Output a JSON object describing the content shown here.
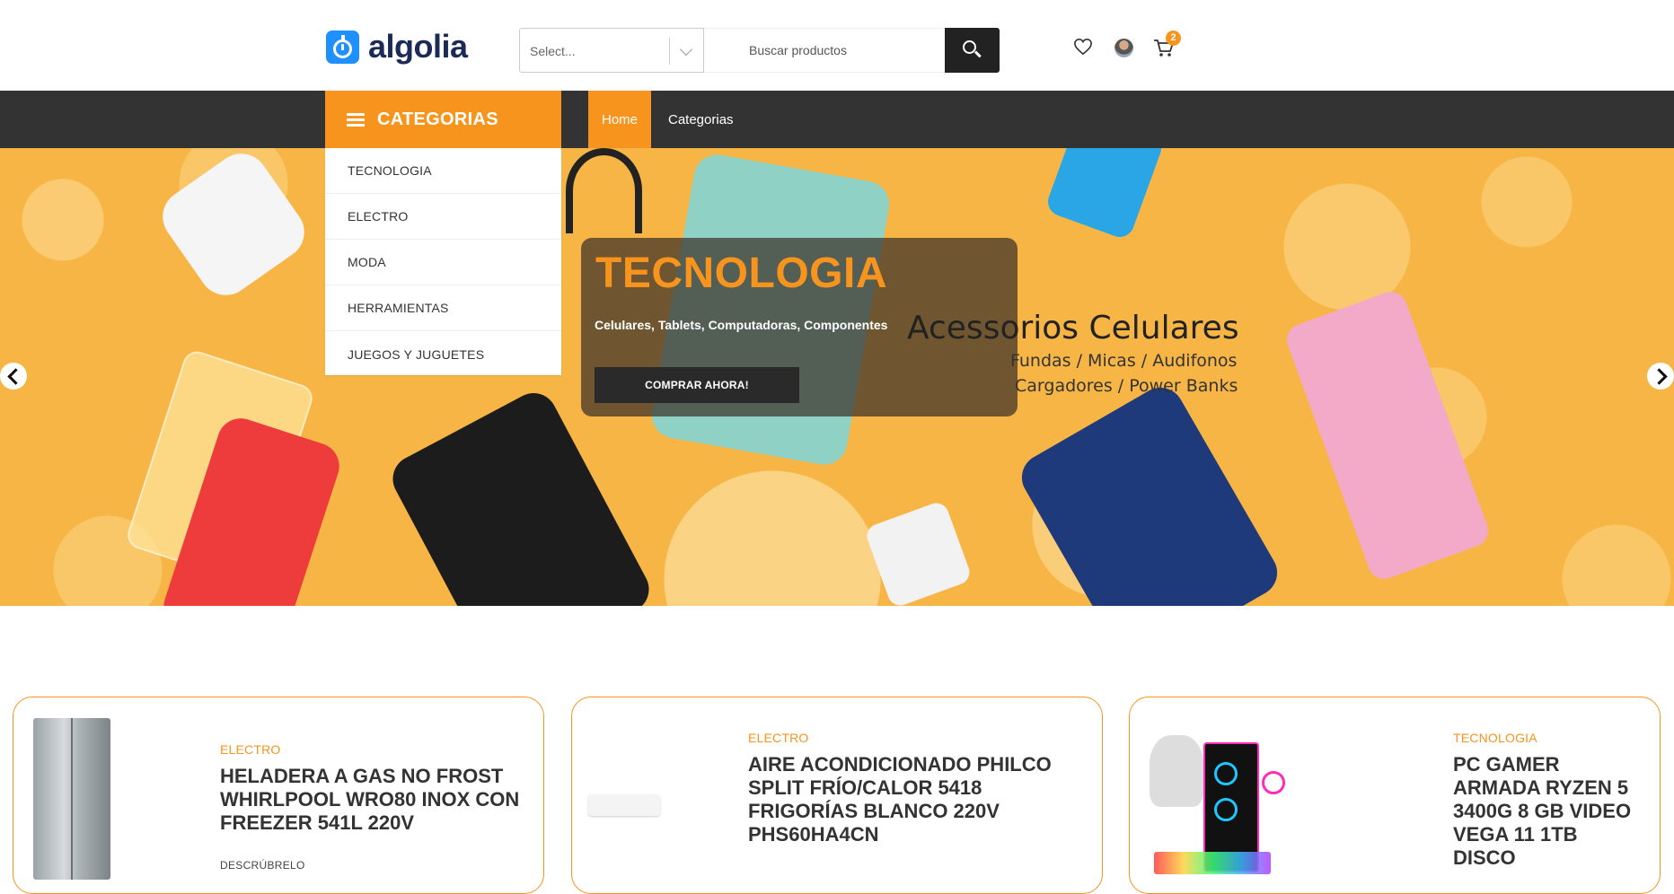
{
  "header": {
    "logo_text": "algolia",
    "search": {
      "category_value": "Select...",
      "placeholder": "Buscar productos"
    },
    "cart_count": "2"
  },
  "nav": {
    "categories_label": "CATEGORIAS",
    "links": [
      "Home",
      "Categorias"
    ]
  },
  "categories_menu": [
    "TECNOLOGIA",
    "ELECTRO",
    "MODA",
    "HERRAMIENTAS",
    "JUEGOS Y JUGUETES"
  ],
  "hero": {
    "title": "TECNOLOGIA",
    "subtitle": "Celulares, Tablets, Computadoras, Componentes",
    "cta": "COMPRAR AHORA!",
    "art_title": "Acessorios Celulares",
    "art_line1": "Fundas / Micas / Audifonos",
    "art_line2": "Cargadores / Power Banks"
  },
  "products": [
    {
      "category": "ELECTRO",
      "title": "HELADERA A GAS NO FROST WHIRLPOOL WRO80 INOX CON FREEZER 541L 220V",
      "more": "DESCRÚBRELO"
    },
    {
      "category": "ELECTRO",
      "title": "AIRE ACONDICIONADO PHILCO SPLIT FRÍO/CALOR 5418 FRIGORÍAS BLANCO 220V PHS60HA4CN"
    },
    {
      "category": "TECNOLOGIA",
      "title": "PC GAMER ARMADA RYZEN 5 3400G 8 GB VIDEO VEGA 11 1TB DISCO"
    }
  ],
  "colors": {
    "accent": "#f7941d",
    "nav_bg": "#333333",
    "hero_bg": "#f6b544"
  },
  "icons": [
    "search-icon",
    "heart-icon",
    "avatar",
    "cart-icon",
    "menu-icon",
    "chevron-down-icon",
    "arrow-left-icon",
    "arrow-right-icon"
  ]
}
